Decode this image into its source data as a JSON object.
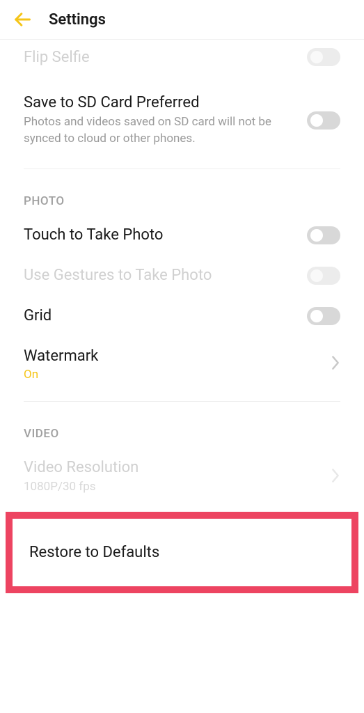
{
  "header": {
    "title": "Settings"
  },
  "flip_selfie": {
    "label": "Flip Selfie"
  },
  "sd_card": {
    "label": "Save to SD Card Preferred",
    "subtitle": "Photos and videos saved on SD card will not be synced to cloud or other phones."
  },
  "sections": {
    "photo": "PHOTO",
    "video": "VIDEO"
  },
  "touch_photo": {
    "label": "Touch to Take Photo"
  },
  "gestures": {
    "label": "Use Gestures to Take Photo"
  },
  "grid": {
    "label": "Grid"
  },
  "watermark": {
    "label": "Watermark",
    "value": "On"
  },
  "video_resolution": {
    "label": "Video Resolution",
    "value": "1080P/30 fps"
  },
  "restore": {
    "label": "Restore to Defaults"
  }
}
